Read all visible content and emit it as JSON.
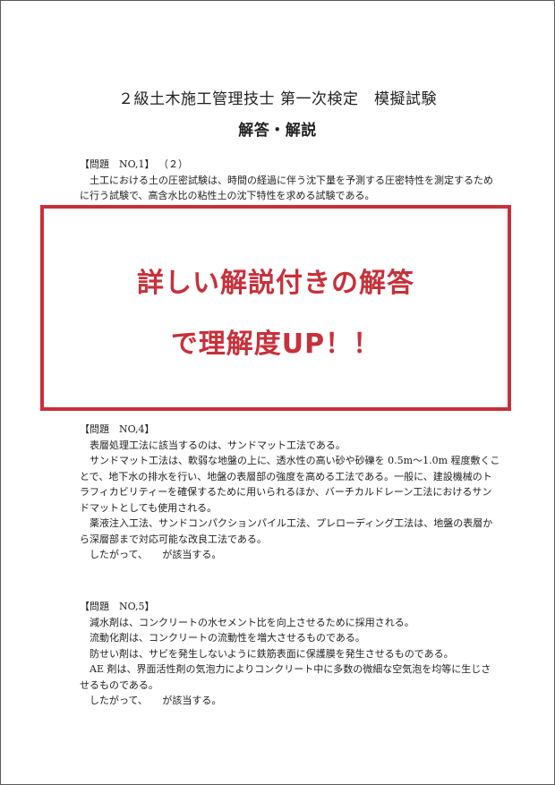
{
  "document": {
    "title": "２級土木施工管理技士 第一次検定　模擬試験",
    "subtitle": "解答・解説"
  },
  "q1": {
    "heading": "【問題　NO,1】",
    "answer": "（２）",
    "lines": [
      "土工における土の圧密試験は、時間の経過に伴う沈下量を予測する圧密特性を測定するため",
      "に行う試験で、高含水比の粘性土の沈下特性を求める試験である。"
    ]
  },
  "promo": {
    "line1": "詳しい解説付きの解答",
    "line2": "で理解度UP！！"
  },
  "q4": {
    "heading": "【問題　NO,4】",
    "lines": [
      "表層処理工法に該当するのは、サンドマット工法である。",
      "サンドマット工法は、軟弱な地盤の上に、透水性の高い砂や砂礫を 0.5m～1.0m 程度敷くこ",
      "とで、地下水の排水を行い、地盤の表層部の強度を高める工法である。一般に、建設機械のト",
      "ラフィカビリティーを確保するために用いられるほか、バーチカルドレーン工法におけるサン",
      "ドマットとしても使用される。",
      "薬液注入工法、サンドコンパクションパイル工法、プレローディング工法は、地盤の表層か",
      "ら深層部まで対応可能な改良工法である。",
      "したがって、　　が該当する。"
    ]
  },
  "q5": {
    "heading": "【問題　NO,5】",
    "lines": [
      "減水剤は、コンクリートの水セメント比を向上させるために採用される。",
      "流動化剤は、コンクリートの流動性を増大させるものである。",
      "防せい剤は、サビを発生しないように鉄筋表面に保護膜を発生させるものである。",
      "AE 剤は、界面活性剤の気泡力によりコンクリート中に多数の微細な空気泡を均等に生じさ",
      "せるものである。",
      "したがって、　　が該当する。"
    ]
  }
}
